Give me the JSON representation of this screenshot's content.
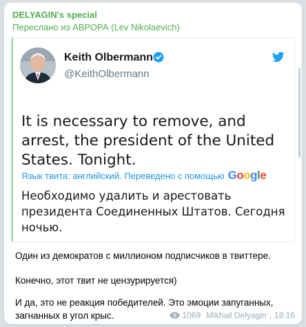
{
  "message": {
    "channel_name": "DELYAGIN's special",
    "forwarded_from": "Переслано из АВРОРА (Lev Nikolaevich)",
    "tweet": {
      "author_name": "Keith Olbermann",
      "handle": "@KeithOlbermann",
      "text": "It is necessary to remove, and arrest, the president of the United States. Tonight.",
      "translate_label": "Язык твита: английский. Переведено с помощью",
      "google_logo": "Google",
      "translated_text": "Необходимо удалить и арестовать президента Соединенных Штатов. Сегодня ночью."
    },
    "paragraphs": [
      "Один из демократов с миллионом подписчиков в твиттере.",
      "Конечно, этот твит не цензурируется)",
      "И да, это не реакция победителей. Это эмоции запуганных, загнанных в угол крыс."
    ],
    "views": "1069",
    "author_signature": "Mikhail Delyagin",
    "time": "18:16"
  },
  "colors": {
    "channel_green": "#4fae4e",
    "link_blue": "#1b95e0",
    "verified_blue": "#1da1f2",
    "meta_gray": "#a0acb6"
  },
  "icons": [
    "verified-badge-icon",
    "twitter-bird-icon",
    "eye-icon"
  ]
}
